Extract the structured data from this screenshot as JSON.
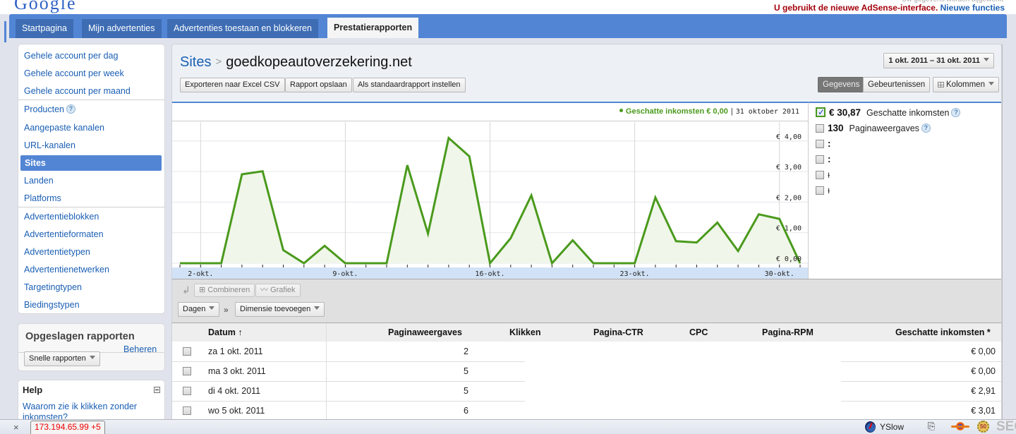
{
  "header": {
    "logo_fragment": "Google",
    "faint_text": "Uw gegevens worden bijgewerkt",
    "notice_red": "U gebruikt de nieuwe AdSense-interface.",
    "notice_link": "Nieuwe functies"
  },
  "tabs": [
    {
      "label": "Startpagina",
      "active": false
    },
    {
      "label": "Mijn advertenties",
      "active": false
    },
    {
      "label": "Advertenties toestaan en blokkeren",
      "active": false
    },
    {
      "label": "Prestatierapporten",
      "active": true
    }
  ],
  "sidebar": {
    "items": [
      {
        "label": "Gehele account per dag"
      },
      {
        "label": "Gehele account per week"
      },
      {
        "label": "Gehele account per maand"
      },
      {
        "label": "Producten",
        "help": "?"
      },
      {
        "label": "Aangepaste kanalen"
      },
      {
        "label": "URL-kanalen"
      },
      {
        "label": "Sites",
        "active": true
      },
      {
        "label": "Landen"
      },
      {
        "label": "Platforms"
      },
      {
        "label": "Advertentieblokken"
      },
      {
        "label": "Advertentieformaten"
      },
      {
        "label": "Advertentietypen"
      },
      {
        "label": "Advertentienetwerken"
      },
      {
        "label": "Targetingtypen"
      },
      {
        "label": "Biedingstypen"
      }
    ],
    "saved_reports": {
      "title": "Opgeslagen rapporten",
      "manage": "Beheren",
      "quick_reports": "Snelle rapporten"
    },
    "help": {
      "title": "Help",
      "link": "Waarom zie ik klikken zonder inkomsten?"
    }
  },
  "main": {
    "breadcrumb": {
      "root": "Sites",
      "separator": ">",
      "current": "goedkopeautoverzekering.net"
    },
    "actions": {
      "export": "Exporteren naar Excel CSV",
      "save": "Rapport opslaan",
      "set_default": "Als standaardrapport instellen"
    },
    "date_range": "1 okt. 2011 – 31 okt. 2011",
    "view_toggle": {
      "data": "Gegevens",
      "events": "Gebeurtenissen"
    },
    "columns_button": "Kolommen",
    "chart_legend": {
      "metric": "Geschatte inkomsten € 0,00",
      "separator": "|",
      "date": "31 oktober 2011"
    },
    "metrics": [
      {
        "value": "€ 30,87",
        "label": "Geschatte inkomsten",
        "checked": true,
        "help": "?"
      },
      {
        "value": "130",
        "label": "Paginaweergaves",
        "checked": false,
        "help": "?"
      },
      {
        "value": ":",
        "label": "",
        "checked": false
      },
      {
        "value": ":",
        "label": "",
        "checked": false
      },
      {
        "value": "ɫ",
        "label": "",
        "checked": false
      },
      {
        "value": "ɫ",
        "label": "",
        "checked": false
      }
    ],
    "toolbar": {
      "combine": "Combineren",
      "chart": "Grafiek",
      "dimension": "Dagen",
      "raquo": "»",
      "add_dimension": "Dimensie toevoegen"
    },
    "table": {
      "columns": [
        "Datum",
        "Paginaweergaves",
        "Klikken",
        "Pagina-CTR",
        "CPC",
        "Pagina-RPM",
        "Geschatte inkomsten *"
      ],
      "sort_indicator": "↑",
      "rows": [
        {
          "date": "za 1 okt. 2011",
          "pageviews": "2",
          "earnings": "€ 0,00"
        },
        {
          "date": "ma 3 okt. 2011",
          "pageviews": "5",
          "earnings": "€ 0,00"
        },
        {
          "date": "di 4 okt. 2011",
          "pageviews": "5",
          "earnings": "€ 2,91"
        },
        {
          "date": "wo 5 okt. 2011",
          "pageviews": "6",
          "earnings": "€ 3,01"
        }
      ]
    }
  },
  "statusbar": {
    "close": "×",
    "ip": "173.194.65.99 +5",
    "yslow": "YSlow",
    "pages_icon": "⎘",
    "seo_badge": "50",
    "seo": "SEO"
  },
  "chart_data": {
    "type": "area",
    "title": "Geschatte inkomsten",
    "series": [
      {
        "name": "Geschatte inkomsten",
        "color": "#4a9a1c",
        "x": [
          "1-okt",
          "2-okt",
          "3-okt",
          "4-okt",
          "5-okt",
          "6-okt",
          "7-okt",
          "8-okt",
          "9-okt",
          "10-okt",
          "11-okt",
          "12-okt",
          "13-okt",
          "14-okt",
          "15-okt",
          "16-okt",
          "17-okt",
          "18-okt",
          "19-okt",
          "20-okt",
          "21-okt",
          "22-okt",
          "23-okt",
          "24-okt",
          "25-okt",
          "26-okt",
          "27-okt",
          "28-okt",
          "29-okt",
          "30-okt",
          "31-okt"
        ],
        "values": [
          0,
          0,
          0,
          2.91,
          3.01,
          0.43,
          0,
          0.57,
          0,
          0,
          0,
          3.21,
          0.97,
          4.1,
          3.5,
          0,
          0.82,
          2.22,
          0,
          0.75,
          0,
          0,
          0,
          2.15,
          0.72,
          0.68,
          1.33,
          0.4,
          1.6,
          1.45,
          0
        ]
      }
    ],
    "x_tick_labels": [
      "2-okt.",
      "9-okt.",
      "16-okt.",
      "23-okt.",
      "30-okt."
    ],
    "x_tick_days": [
      2,
      9,
      16,
      23,
      30
    ],
    "y_tick_labels": [
      "€ 0,00",
      "€ 1,00",
      "€ 2,00",
      "€ 3,00",
      "€ 4,00"
    ],
    "y_ticks": [
      0,
      1,
      2,
      3,
      4
    ],
    "ylim": [
      0,
      4.4
    ],
    "xlabel": "",
    "ylabel": "",
    "grid": true,
    "legend": "top-right"
  }
}
